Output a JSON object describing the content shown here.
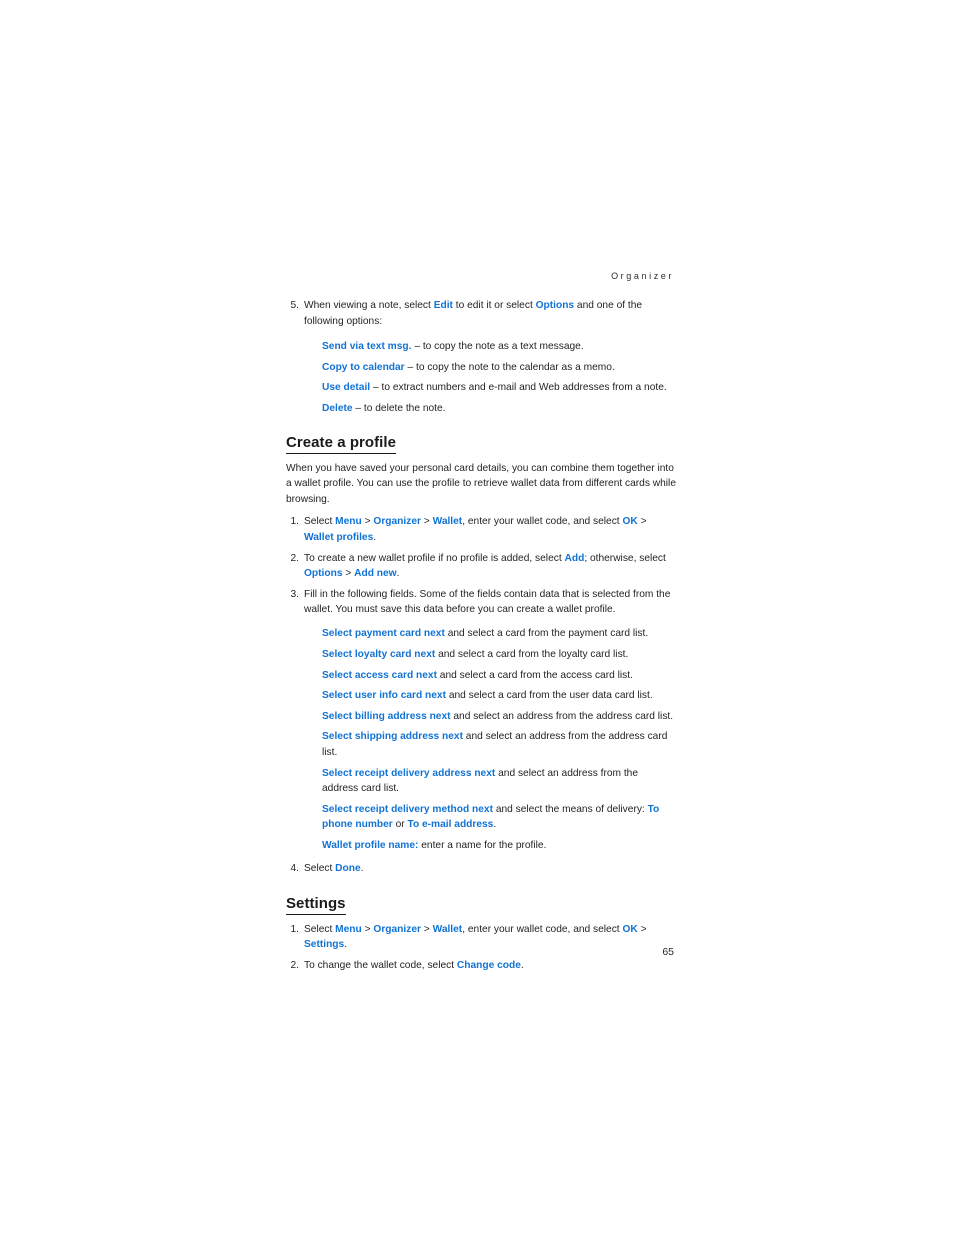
{
  "page": {
    "running_header": "Organizer",
    "folio": "65",
    "accent_color": "#1273d4",
    "text_color": "#231f20"
  },
  "blocks": {
    "item5": {
      "num": "5.",
      "t1": "When viewing a note, select ",
      "ui1": "Edit",
      "t2": " to edit it or select ",
      "ui2": "Options",
      "t3": " and one of the following options:"
    },
    "note_options": [
      {
        "term": "Send via text msg.",
        "dash": "–",
        "desc": " to copy the note as a text message."
      },
      {
        "term": "Copy to calendar",
        "dash": "–",
        "desc": " to copy the note to the calendar as a memo."
      },
      {
        "term": "Use detail",
        "dash": "–",
        "desc": " to extract numbers and e-mail and Web addresses from a note."
      },
      {
        "term": "Delete",
        "dash": "–",
        "desc": " to delete the note."
      }
    ],
    "create_profile": {
      "heading": "Create a profile",
      "intro": "When you have saved your personal card details, you can combine them together into a wallet profile. You can use the profile to retrieve wallet data from different cards while browsing.",
      "step1": {
        "num": "1.",
        "t1": "Select ",
        "ui_menu": "Menu",
        "sep1": " > ",
        "ui_organizer": "Organizer",
        "sep2": " > ",
        "ui_wallet": "Wallet",
        "t2": ", enter your wallet code, and select ",
        "ui_ok": "OK",
        "sep3": "  >  ",
        "ui_profiles": "Wallet profiles",
        "t3": "."
      },
      "step2": {
        "num": "2.",
        "t1": "To create a new wallet profile if no profile is added, select ",
        "ui_add": "Add",
        "t2": "; otherwise, select ",
        "ui_options": "Options",
        "sep1": " > ",
        "ui_addnew": "Add new",
        "t3": "."
      },
      "step3": {
        "num": "3.",
        "t1": "Fill in the following fields. Some of the fields contain data that is selected from the wallet. You must save this data before you can create a wallet profile."
      },
      "fields": [
        {
          "term": "Select payment card next",
          "desc": " and select a card from the payment card list."
        },
        {
          "term": "Select loyalty card next",
          "desc": " and select a card from the loyalty card list."
        },
        {
          "term": "Select access card next",
          "desc": " and select a card from the access card list."
        },
        {
          "term": "Select user info card next",
          "desc": " and select a card from the user data card list."
        },
        {
          "term": "Select billing address next",
          "desc": " and select an address from the address card list."
        },
        {
          "term": "Select shipping address next",
          "desc": " and select an address from the address card list."
        },
        {
          "term": "Select receipt delivery address next",
          "desc": " and select an address from the address card list."
        }
      ],
      "delivery_method": {
        "term": "Select receipt delivery method next",
        "mid": " and select the means of delivery: ",
        "opt1": "To phone number",
        "conj": " or ",
        "opt2": "To e-mail address",
        "end": "."
      },
      "profile_name": {
        "term": "Wallet profile name:",
        "desc": " enter a name for the profile."
      },
      "step4": {
        "num": "4.",
        "t1": "Select ",
        "ui_done": "Done",
        "t2": "."
      }
    },
    "settings": {
      "heading": "Settings",
      "step1": {
        "num": "1.",
        "t1": "Select ",
        "ui_menu": "Menu",
        "sep1": " > ",
        "ui_organizer": "Organizer",
        "sep2": " > ",
        "ui_wallet": "Wallet",
        "t2": ", enter your wallet code, and select ",
        "ui_ok": "OK",
        "sep3": " > ",
        "ui_settings": "Settings",
        "t3": "."
      },
      "step2": {
        "num": "2.",
        "t1": "To change the wallet code, select ",
        "ui_change": "Change code",
        "t2": "."
      }
    }
  }
}
